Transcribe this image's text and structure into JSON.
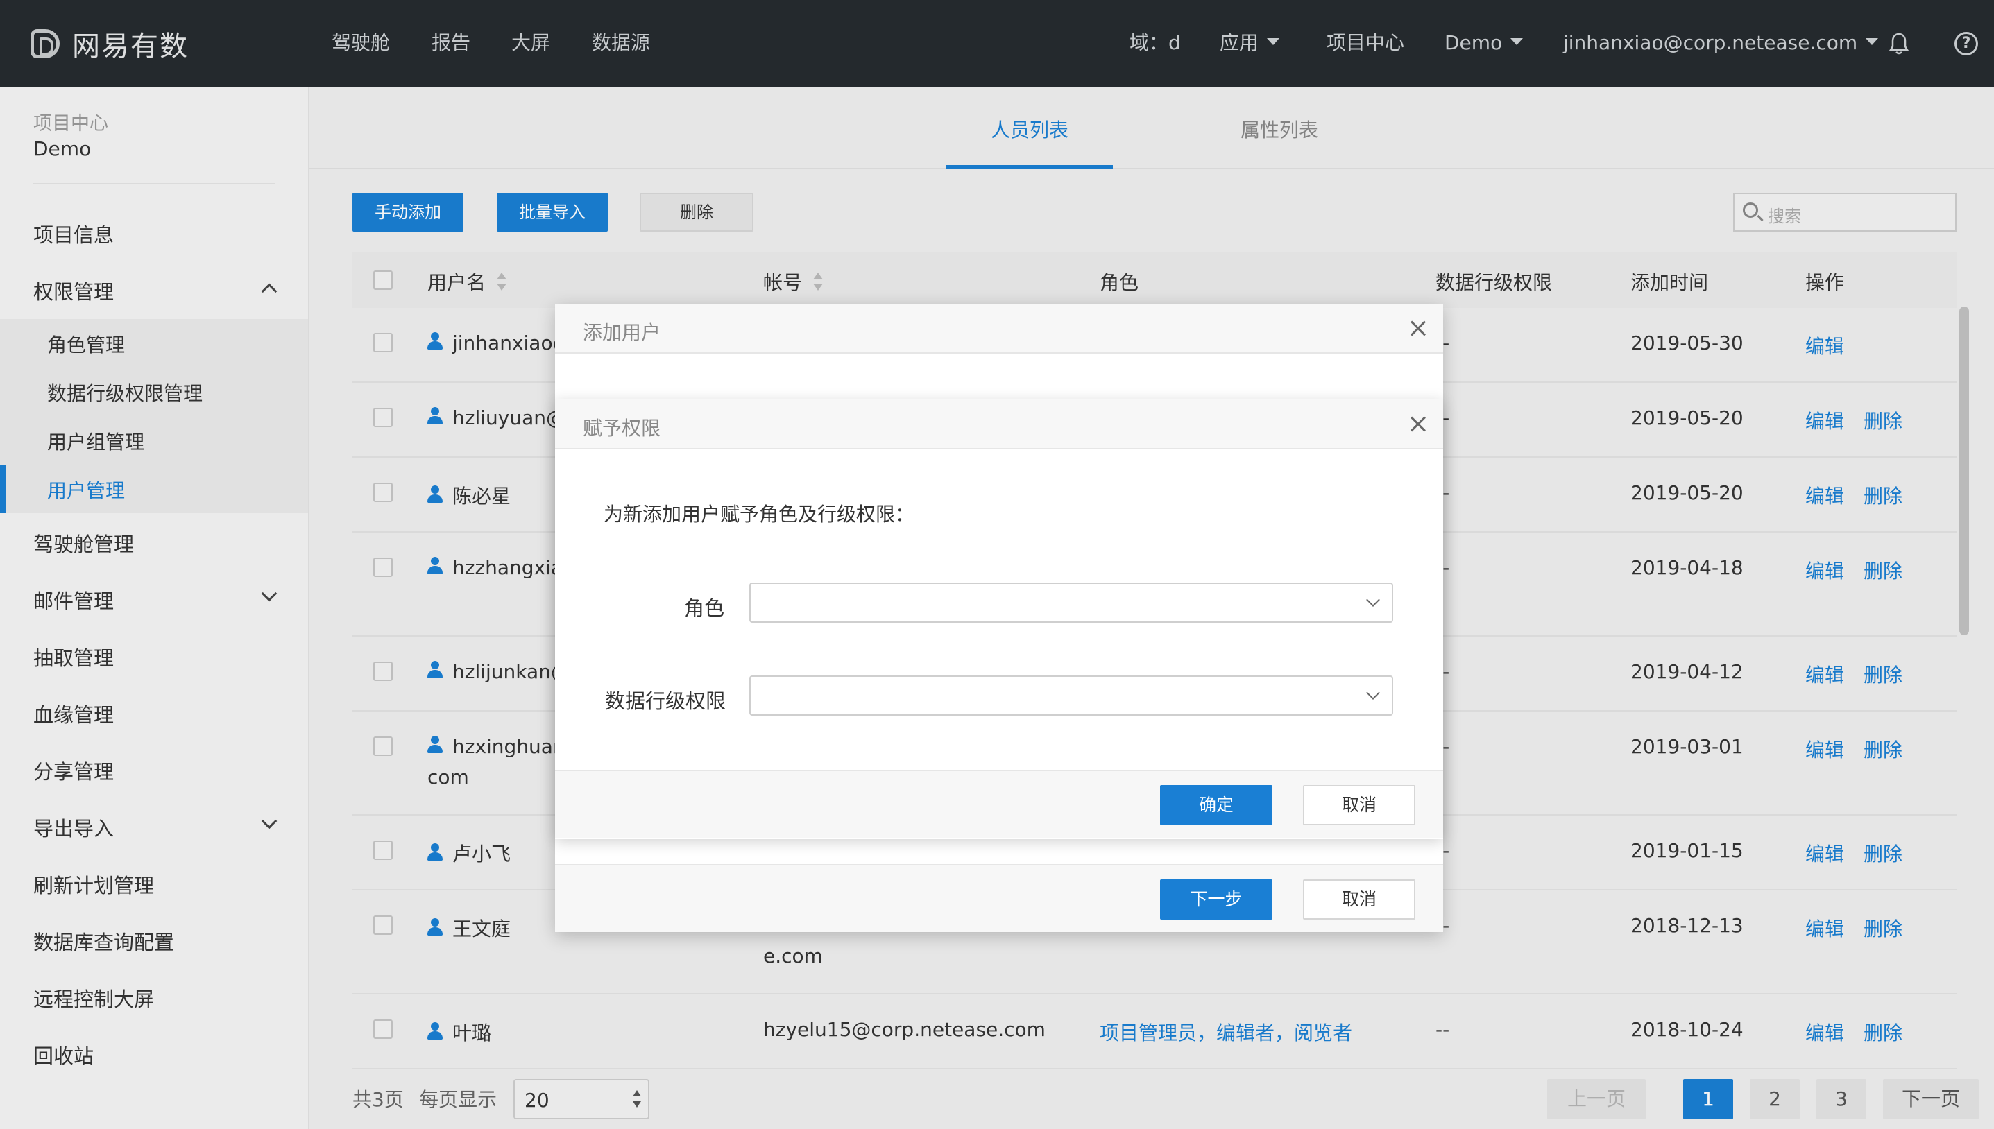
{
  "app": {
    "logo_text": "网易有数",
    "nav": [
      "驾驶舱",
      "报告",
      "大屏",
      "数据源"
    ],
    "domain": "域：d",
    "apps_label": "应用",
    "project_center": "项目中心",
    "project_switch": "Demo",
    "user_email": "jinhanxiao@corp.netease.com",
    "help_glyph": "?"
  },
  "sidebar": {
    "crumb": "项目中心",
    "project": "Demo",
    "items": {
      "project_info": "项目信息",
      "permission": "权限管理",
      "role_mgmt": "角色管理",
      "row_perm_mgmt": "数据行级权限管理",
      "group_mgmt": "用户组管理",
      "user_mgmt": "用户管理",
      "cockpit_mgmt": "驾驶舱管理",
      "mail_mgmt": "邮件管理",
      "extract_mgmt": "抽取管理",
      "lineage_mgmt": "血缘管理",
      "share_mgmt": "分享管理",
      "import_export": "导出导入",
      "refresh_plan": "刷新计划管理",
      "db_query_config": "数据库查询配置",
      "remote_screen": "远程控制大屏",
      "recycle_bin": "回收站"
    }
  },
  "tabs": {
    "members": "人员列表",
    "attributes": "属性列表"
  },
  "toolbar": {
    "manual_add": "手动添加",
    "batch_import": "批量导入",
    "delete": "删除",
    "search_placeholder": "搜索"
  },
  "table": {
    "headers": {
      "username": "用户名",
      "account": "帐号",
      "role": "角色",
      "row_perm": "数据行级权限",
      "added": "添加时间",
      "ops": "操作"
    },
    "rows": [
      {
        "name": "jinhanxiao@",
        "name2": "",
        "account": "",
        "account2": "",
        "role": "",
        "row_perm": "--",
        "date": "2019-05-30",
        "edit": "编辑",
        "del": ""
      },
      {
        "name": "hzliuyuan@",
        "name2": "",
        "account": "",
        "account2": "",
        "role": "",
        "row_perm": "--",
        "date": "2019-05-20",
        "edit": "编辑",
        "del": "删除"
      },
      {
        "name": "陈必星",
        "name2": "",
        "account": "",
        "account2": "",
        "role": "",
        "row_perm": "--",
        "date": "2019-05-20",
        "edit": "编辑",
        "del": "删除"
      },
      {
        "name": "hzzhangxia",
        "name2": "",
        "account": "",
        "account2": "",
        "role": "",
        "row_perm": "--",
        "date": "2019-04-18",
        "edit": "编辑",
        "del": "删除"
      },
      {
        "name": "hzlijunkan@",
        "name2": "",
        "account": "",
        "account2": "",
        "role": "",
        "row_perm": "--",
        "date": "2019-04-12",
        "edit": "编辑",
        "del": "删除"
      },
      {
        "name": "hzxinghuan",
        "name2": "com",
        "account": "",
        "account2": "",
        "role": "",
        "row_perm": "--",
        "date": "2019-03-01",
        "edit": "编辑",
        "del": "删除"
      },
      {
        "name": "卢小飞",
        "name2": "",
        "account": "",
        "account2": "",
        "role": "",
        "row_perm": "--",
        "date": "2019-01-15",
        "edit": "编辑",
        "del": "删除"
      },
      {
        "name": "王文庭",
        "name2": "",
        "account": "",
        "account2": "e.com",
        "role": "",
        "row_perm": "--",
        "date": "2018-12-13",
        "edit": "编辑",
        "del": "删除"
      },
      {
        "name": "叶璐",
        "name2": "",
        "account": "hzyelu15@corp.netease.com",
        "account2": "",
        "role": "项目管理员，编辑者，阅览者",
        "row_perm": "--",
        "date": "2018-10-24",
        "edit": "编辑",
        "del": "删除"
      }
    ]
  },
  "pagination": {
    "total": "共3页",
    "per_page_label": "每页显示",
    "per_page": "20",
    "prev": "上一页",
    "pages": [
      "1",
      "2",
      "3"
    ],
    "next": "下一页"
  },
  "dialog_add_user": {
    "title": "添加用户",
    "next": "下一步",
    "cancel": "取消"
  },
  "dialog_grant": {
    "title": "赋予权限",
    "intro": "为新添加用户赋予角色及行级权限：",
    "role_label": "角色",
    "row_perm_label": "数据行级权限",
    "role_value": "",
    "row_perm_value": "",
    "confirm": "确定",
    "cancel": "取消"
  },
  "colors": {
    "accent": "#1a7fd4",
    "topbar": "#262b2f"
  },
  "icons": [
    "logo-icon",
    "bell-icon",
    "help-icon",
    "search-icon",
    "user-icon",
    "close-icon",
    "chevron-down-icon",
    "chevron-up-icon",
    "sort-icon"
  ]
}
